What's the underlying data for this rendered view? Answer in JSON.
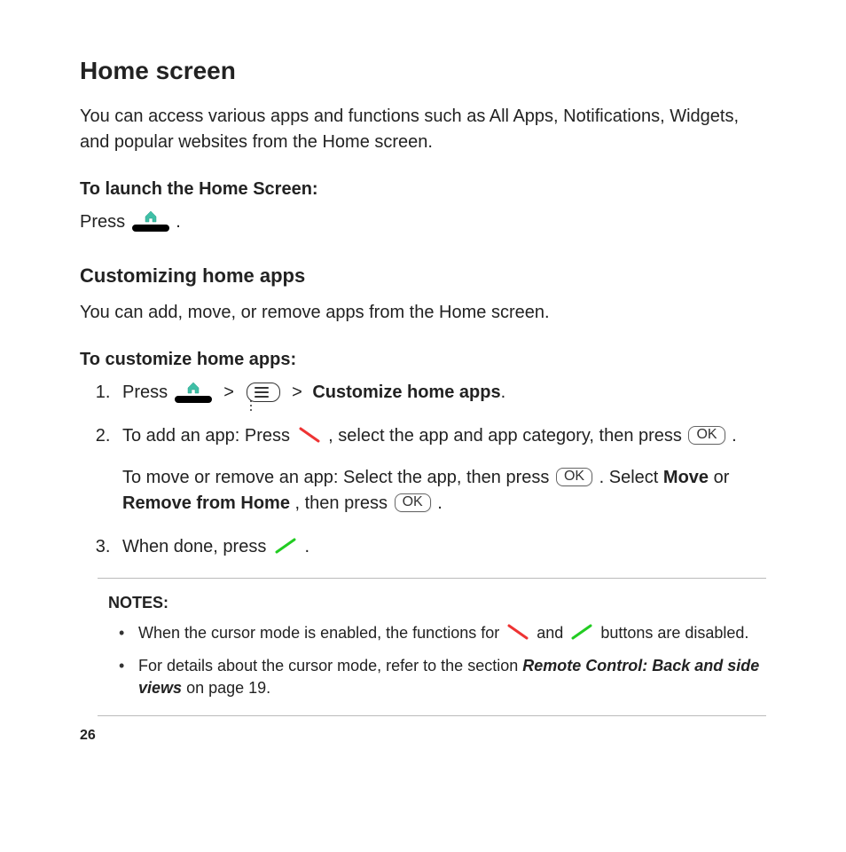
{
  "h1": "Home screen",
  "intro": "You can access various apps and functions such as All Apps, Notifications, Widgets, and popular websites from the Home screen.",
  "launch_head": "To launch the Home Screen:",
  "launch_press": "Press ",
  "period": " .",
  "h2": "Customizing home apps",
  "customize_intro": "You can add, move, or remove apps from the Home screen.",
  "customize_head": "To customize  home apps:",
  "step1_press": "Press ",
  "sep": ">",
  "step1_action": "Customize home apps",
  "step2a_1": "To add an app: Press ",
  "step2a_2": ", select the app and app category, then press ",
  "step2b_1": "To move or remove an app: Select the app, then press ",
  "step2b_2": ".  Select ",
  "move": "Move",
  "step2b_3": " or ",
  "remove": "Remove from Home",
  "step2b_4": ", then press ",
  "step3": "When done, press ",
  "ok_label": "OK",
  "notes_title": "NOTES:",
  "note1_a": "When the cursor mode is enabled, the functions for ",
  "note1_b": " and ",
  "note1_c": " buttons are disabled.",
  "note2_a": "For details about the cursor mode, refer to the section ",
  "note2_ref": "Remote Control: Back and side views",
  "note2_b": " on page 19.",
  "page_num": "26"
}
